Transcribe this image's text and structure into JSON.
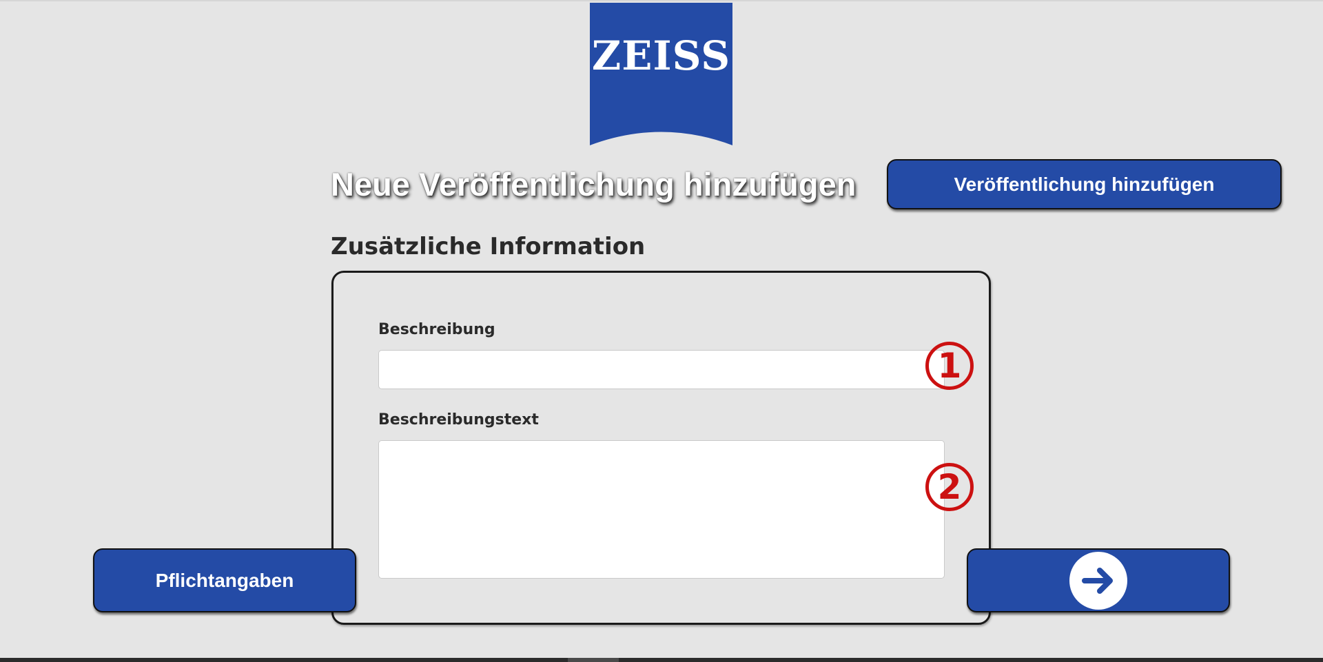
{
  "brand": {
    "logo_text": "ZEISS",
    "logo_color": "#244ba6"
  },
  "header": {
    "title": "Neue Veröffentlichung hinzufügen",
    "add_publication_button": "Veröffentlichung hinzufügen"
  },
  "section": {
    "heading": "Zusätzliche Information"
  },
  "form": {
    "description_label": "Beschreibung",
    "description_value": "",
    "description_text_label": "Beschreibungstext",
    "description_text_value": ""
  },
  "markers": {
    "first": "1",
    "second": "2"
  },
  "navigation": {
    "required_fields_button": "Pflichtangaben",
    "next_button_icon": "arrow-right-icon"
  },
  "colors": {
    "background": "#e5e5e5",
    "button_blue": "#244ba6",
    "marker_red": "#cc1111"
  }
}
